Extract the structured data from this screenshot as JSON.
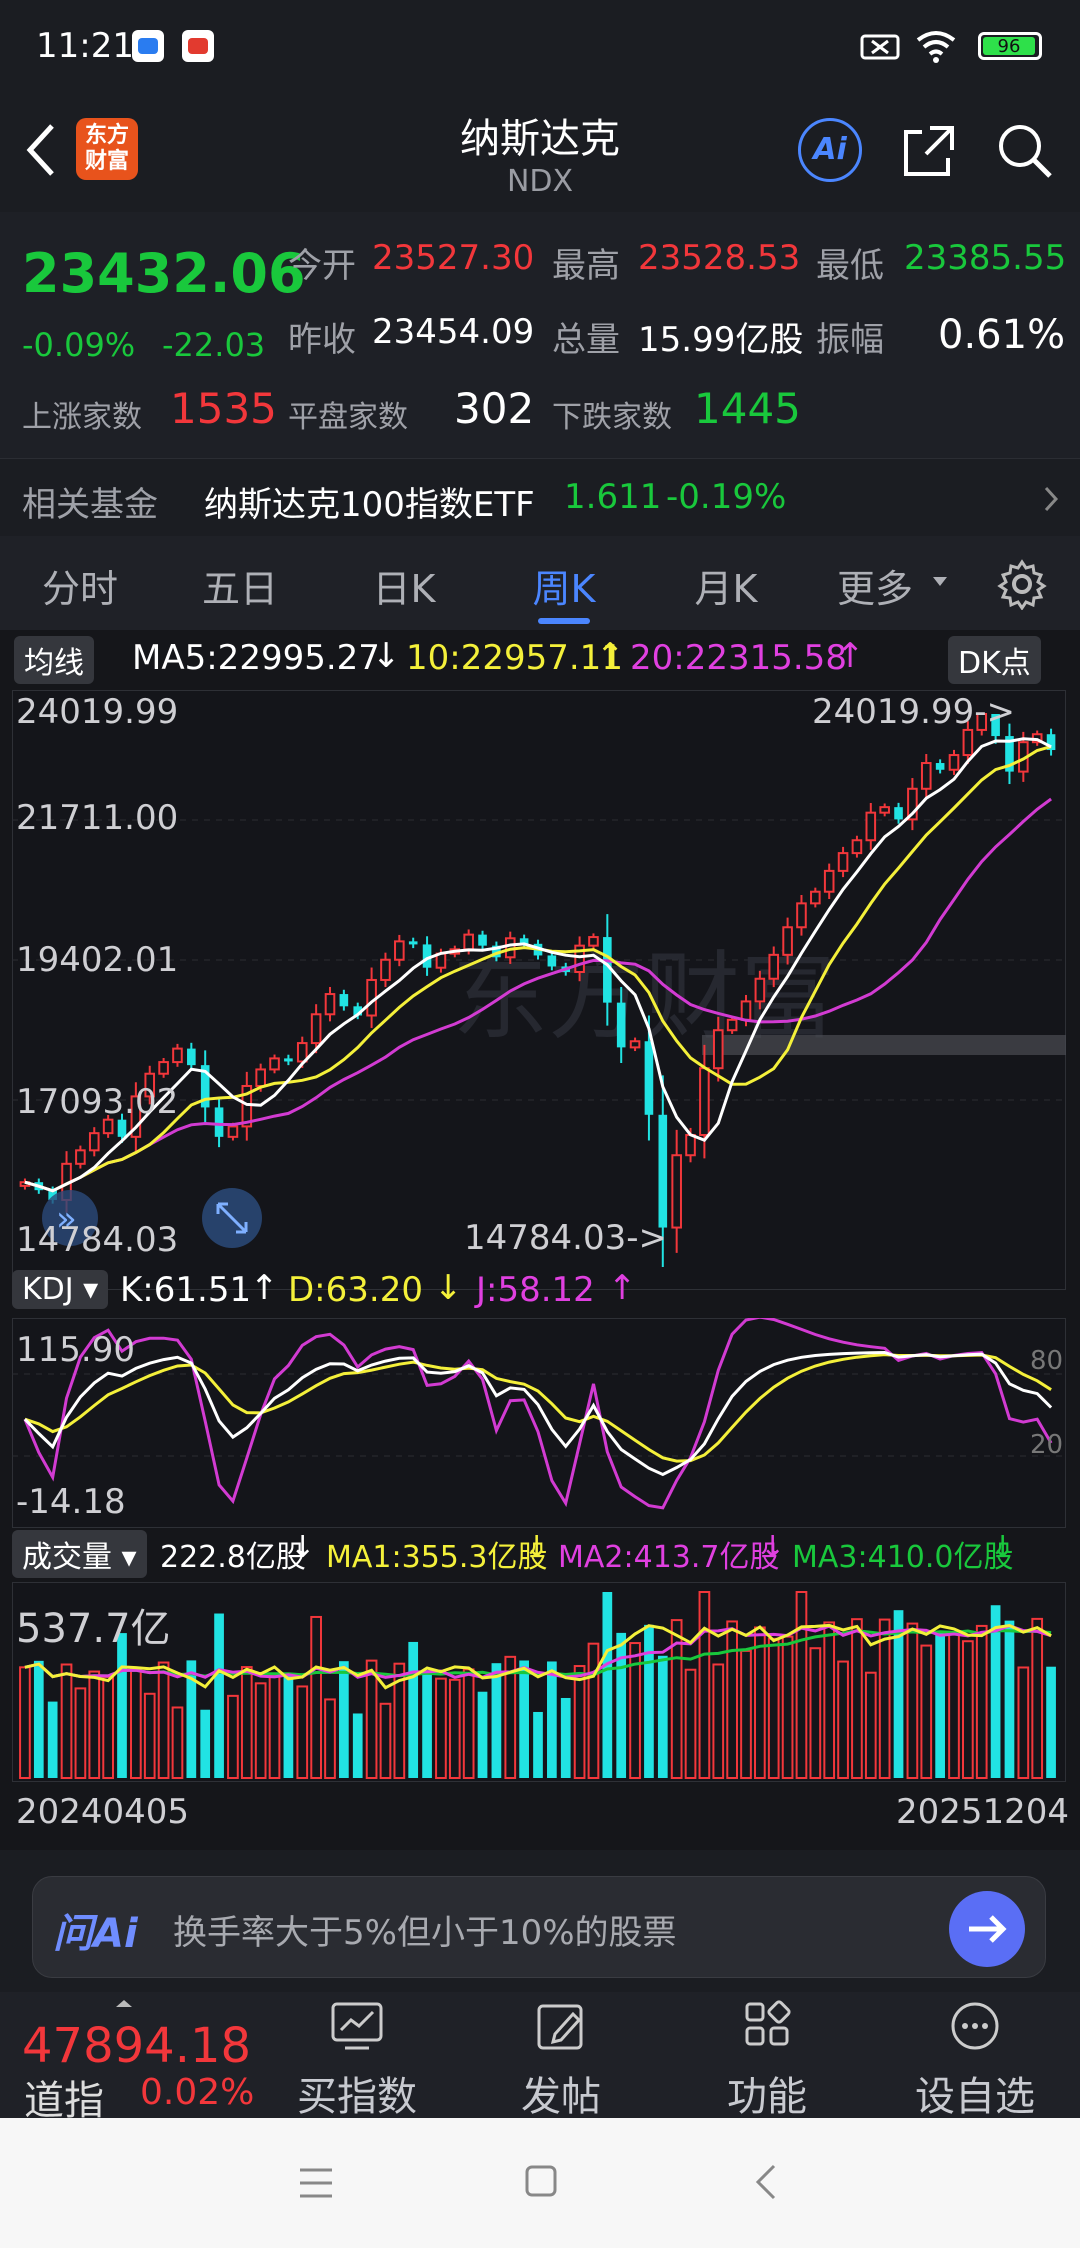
{
  "status": {
    "time": "11:21",
    "battery": "96"
  },
  "header": {
    "title": "纳斯达克",
    "code": "NDX",
    "logo_text": "东方财富",
    "ai_label": "Ai"
  },
  "quote": {
    "price": "23432.06",
    "change_pct": "-0.09%",
    "change": "-22.03",
    "open_label": "今开",
    "open": "23527.30",
    "high_label": "最高",
    "high": "23528.53",
    "low_label": "最低",
    "low": "23385.55",
    "prev_label": "昨收",
    "prev": "23454.09",
    "vol_label": "总量",
    "vol": "15.99亿股",
    "amp_label": "振幅",
    "amp": "0.61%",
    "up_label": "上涨家数",
    "up": "1535",
    "flat_label": "平盘家数",
    "flat": "302",
    "down_label": "下跌家数",
    "down": "1445"
  },
  "fund": {
    "label": "相关基金",
    "name": "纳斯达克100指数ETF",
    "price": "1.611",
    "chg": "-0.19%"
  },
  "tabs": [
    "分时",
    "五日",
    "日K",
    "周K",
    "月K",
    "更多"
  ],
  "main_legend": {
    "btn": "均线",
    "ma5": "MA5:22995.27",
    "ma10": "10:22957.11",
    "ma20": "20:22315.58",
    "dk": "DK点"
  },
  "kdj_legend": {
    "btn": "KDJ",
    "k": "K:61.51",
    "d": "D:63.20",
    "j": "J:58.12"
  },
  "vol_legend": {
    "btn": "成交量",
    "v": "222.8亿股",
    "ma1": "MA1:355.3亿股",
    "ma2": "MA2:413.7亿股",
    "ma3": "MA3:410.0亿股"
  },
  "chart_data": [
    {
      "type": "candlestick",
      "title": "",
      "y_ticks": [
        "24019.99",
        "21711.00",
        "19402.01",
        "17093.02",
        "14784.03"
      ],
      "ylim": [
        14784.03,
        24019.99
      ],
      "max_label": "24019.99->",
      "min_label": "14784.03->",
      "x_start": "20240405",
      "x_end": "20251204",
      "closes": [
        16380,
        16250,
        16090,
        16680,
        16900,
        17180,
        17400,
        17120,
        17780,
        18150,
        18340,
        18560,
        18290,
        17600,
        17120,
        17290,
        17950,
        18220,
        18400,
        18350,
        18650,
        19120,
        19450,
        19250,
        19100,
        19680,
        20010,
        20310,
        20260,
        19880,
        20110,
        20180,
        20420,
        20240,
        20050,
        20360,
        20270,
        20080,
        19900,
        19810,
        20240,
        20380,
        19310,
        18580,
        18680,
        17480,
        15640,
        16820,
        17150,
        18240,
        18860,
        19030,
        19330,
        19700,
        20090,
        20540,
        20930,
        21120,
        21460,
        21750,
        21960,
        22410,
        22500,
        22300,
        22800,
        23220,
        23110,
        23350,
        23760,
        24020,
        23660,
        23080,
        23560,
        23690,
        23432
      ]
    },
    {
      "type": "line",
      "title": "KDJ",
      "y_ticks": [
        "115.90",
        "-14.18"
      ],
      "ref_lines": [
        "80",
        "20"
      ]
    },
    {
      "type": "bar",
      "title": "成交量",
      "y_ticks": [
        "537.7亿"
      ]
    }
  ],
  "ask": {
    "brand": "问Ai",
    "placeholder": "换手率大于5%但小于10%的股票"
  },
  "bottom": {
    "index_price": "47894.18",
    "index_name": "道指",
    "index_chg": "0.02%",
    "nav": [
      "买指数",
      "发帖",
      "功能",
      "设自选"
    ]
  },
  "colors": {
    "up": "#f2373b",
    "down": "#19c83c",
    "accent": "#4b86ff",
    "cyan": "#21e3e3"
  }
}
